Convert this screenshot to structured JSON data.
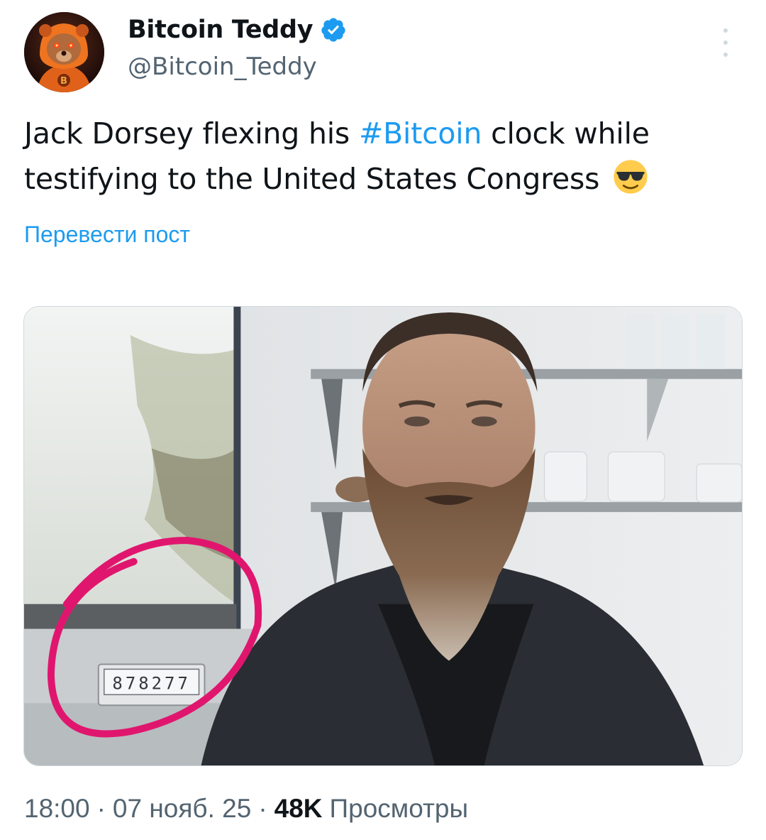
{
  "author": {
    "display_name": "Bitcoin Teddy",
    "handle": "@Bitcoin_Teddy",
    "verified": true,
    "avatar_icon": "teddy-bear-hoodie-bitcoin-avatar",
    "avatar_letter": "B"
  },
  "post": {
    "text_before": "Jack Dorsey flexing his ",
    "hashtag": "#Bitcoin",
    "text_after": " clock while testifying to the United States Congress",
    "emoji": "smiling-face-with-sunglasses",
    "translate_label": "Перевести пост"
  },
  "media": {
    "clock_digits": "878277"
  },
  "footer": {
    "time": "18:00",
    "separator": "·",
    "date": "07 нояб. 25",
    "views_count": "48K",
    "views_label": "Просмотры"
  },
  "colors": {
    "accent": "#1d9bf0",
    "secondary_text": "#536471",
    "primary_text": "#0f1419",
    "annotation_circle": "#e0166e"
  }
}
